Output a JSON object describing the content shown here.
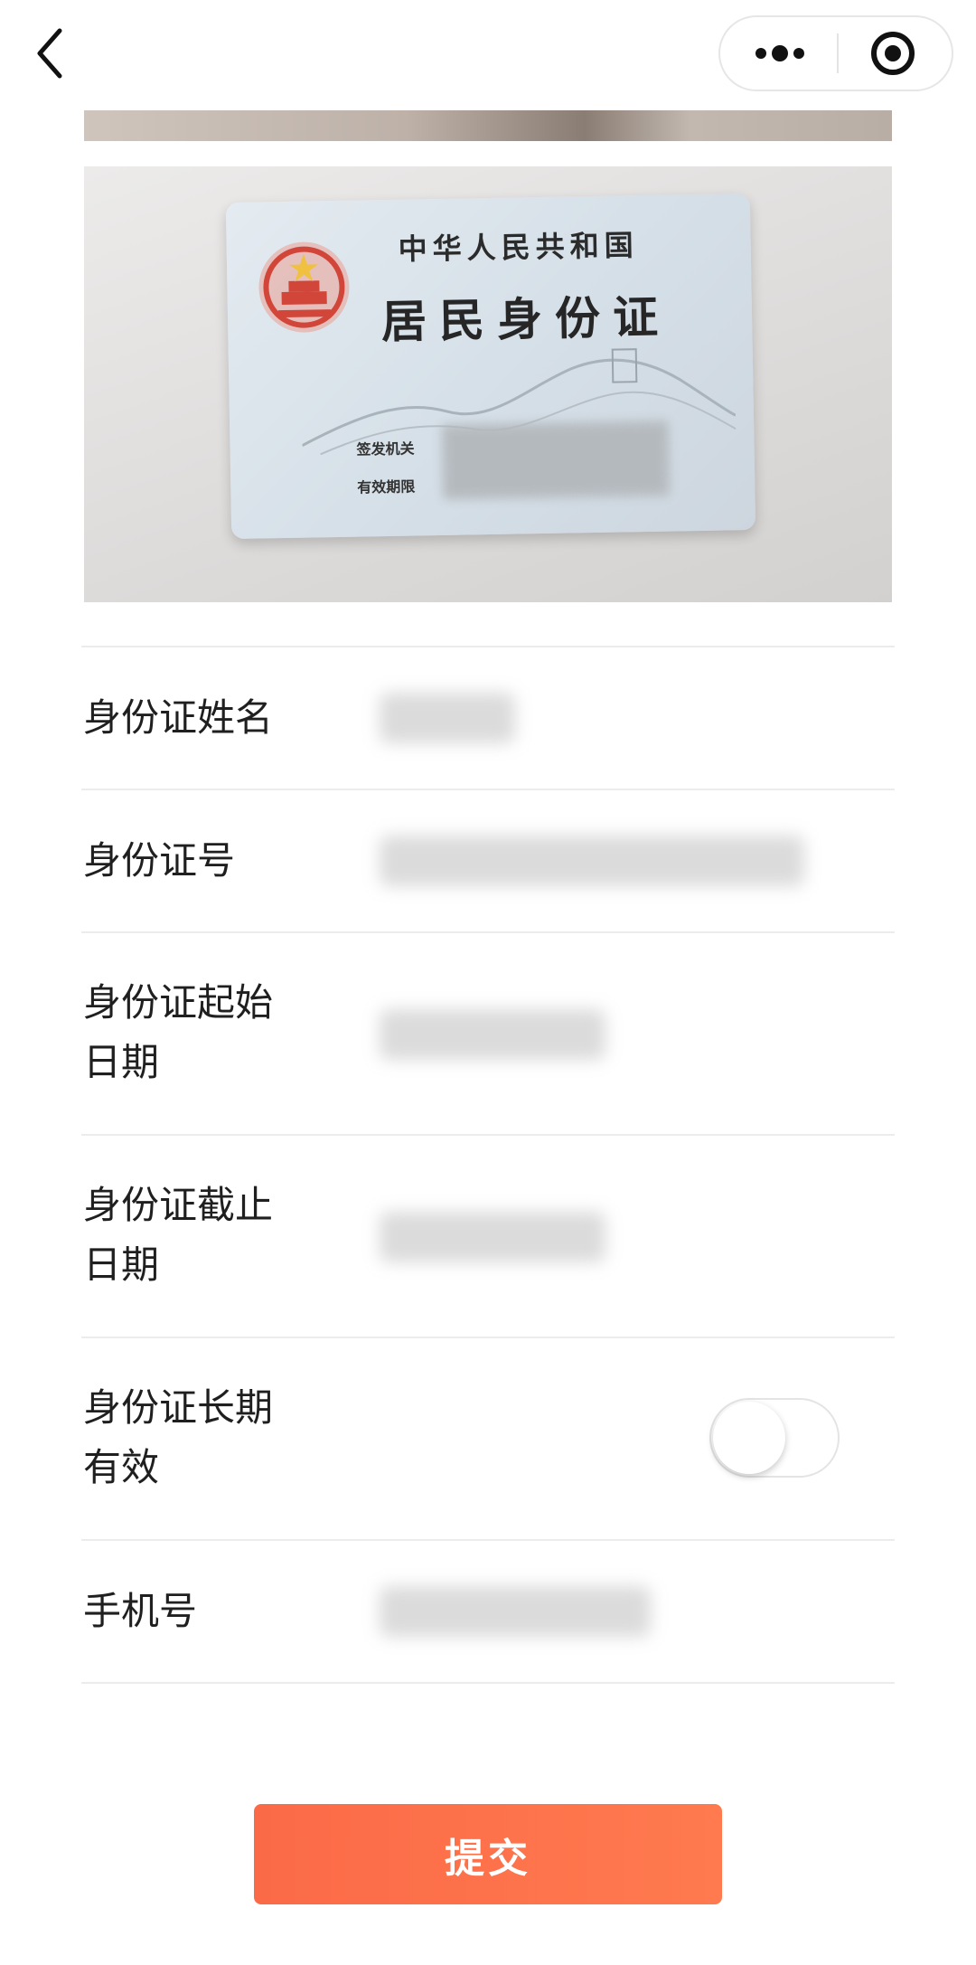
{
  "nav": {
    "back_icon": "chevron-left-icon",
    "more_icon": "more-dots-icon",
    "target_icon": "record-circle-icon"
  },
  "id_card": {
    "line1": "中华人民共和国",
    "line2": "居民身份证",
    "issuer_label": "签发机关",
    "validity_label": "有效期限"
  },
  "form": {
    "name_label": "身份证姓名",
    "number_label": "身份证号",
    "start_label_line1": "身份证起始",
    "start_label_line2": "日期",
    "end_label_line1": "身份证截止",
    "end_label_line2": "日期",
    "longterm_label_line1": "身份证长期",
    "longterm_label_line2": "有效",
    "longterm_enabled": false,
    "phone_label": "手机号"
  },
  "submit_label": "提交",
  "colors": {
    "accent": "#fb6a47",
    "divider": "#ececec"
  }
}
